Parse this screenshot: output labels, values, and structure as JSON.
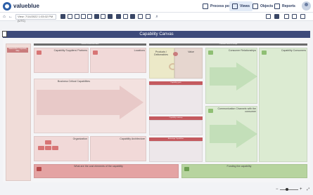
{
  "brand": {
    "name": "valueblue"
  },
  "nav": [
    {
      "label": "Process portal"
    },
    {
      "label": "Views"
    },
    {
      "label": "Objects"
    },
    {
      "label": "Reports"
    }
  ],
  "toolbar": {
    "view_date": "View: 7/14/2022 1:03:02 PM (UTC)"
  },
  "canvas": {
    "title": "Capability Canvas",
    "sections": {
      "top_left": {
        "label": "Internal Governance Area"
      },
      "top_right": {
        "label": "Customer Focus & Design"
      },
      "left_tall": {
        "label": "Stakeholder's Capability Map"
      },
      "suppliers": {
        "label": "Capability Suppliers/ Partners"
      },
      "locations": {
        "label": "Locations"
      },
      "business_critical": {
        "label": "Business Critical Capabilities"
      },
      "organization": {
        "label": "Organization"
      },
      "architecture": {
        "label": "Capability Architecture"
      },
      "products": {
        "label": "Products / Deliverables"
      },
      "value": {
        "label": "Value"
      },
      "goals": {
        "label": "Capability goals"
      },
      "roadmap": {
        "label": "Capability roadmap"
      },
      "investment": {
        "label": "Advantage Capabilities"
      },
      "consumer_relationships": {
        "label": "Consumer Relationships"
      },
      "consumers": {
        "label": "Capability Consumers"
      },
      "communication": {
        "label": "Communication Channels with the consumer"
      },
      "cost": {
        "label": "What are the cost elements of the capability"
      },
      "funding": {
        "label": "Funding the capability"
      }
    }
  },
  "colors": {
    "accent": "#3d4a7a",
    "red_zone": "#f1d9d8",
    "green_zone": "#dcebd2",
    "yellow_zone": "#ece9c8",
    "lav_zone": "#ede7ea"
  }
}
